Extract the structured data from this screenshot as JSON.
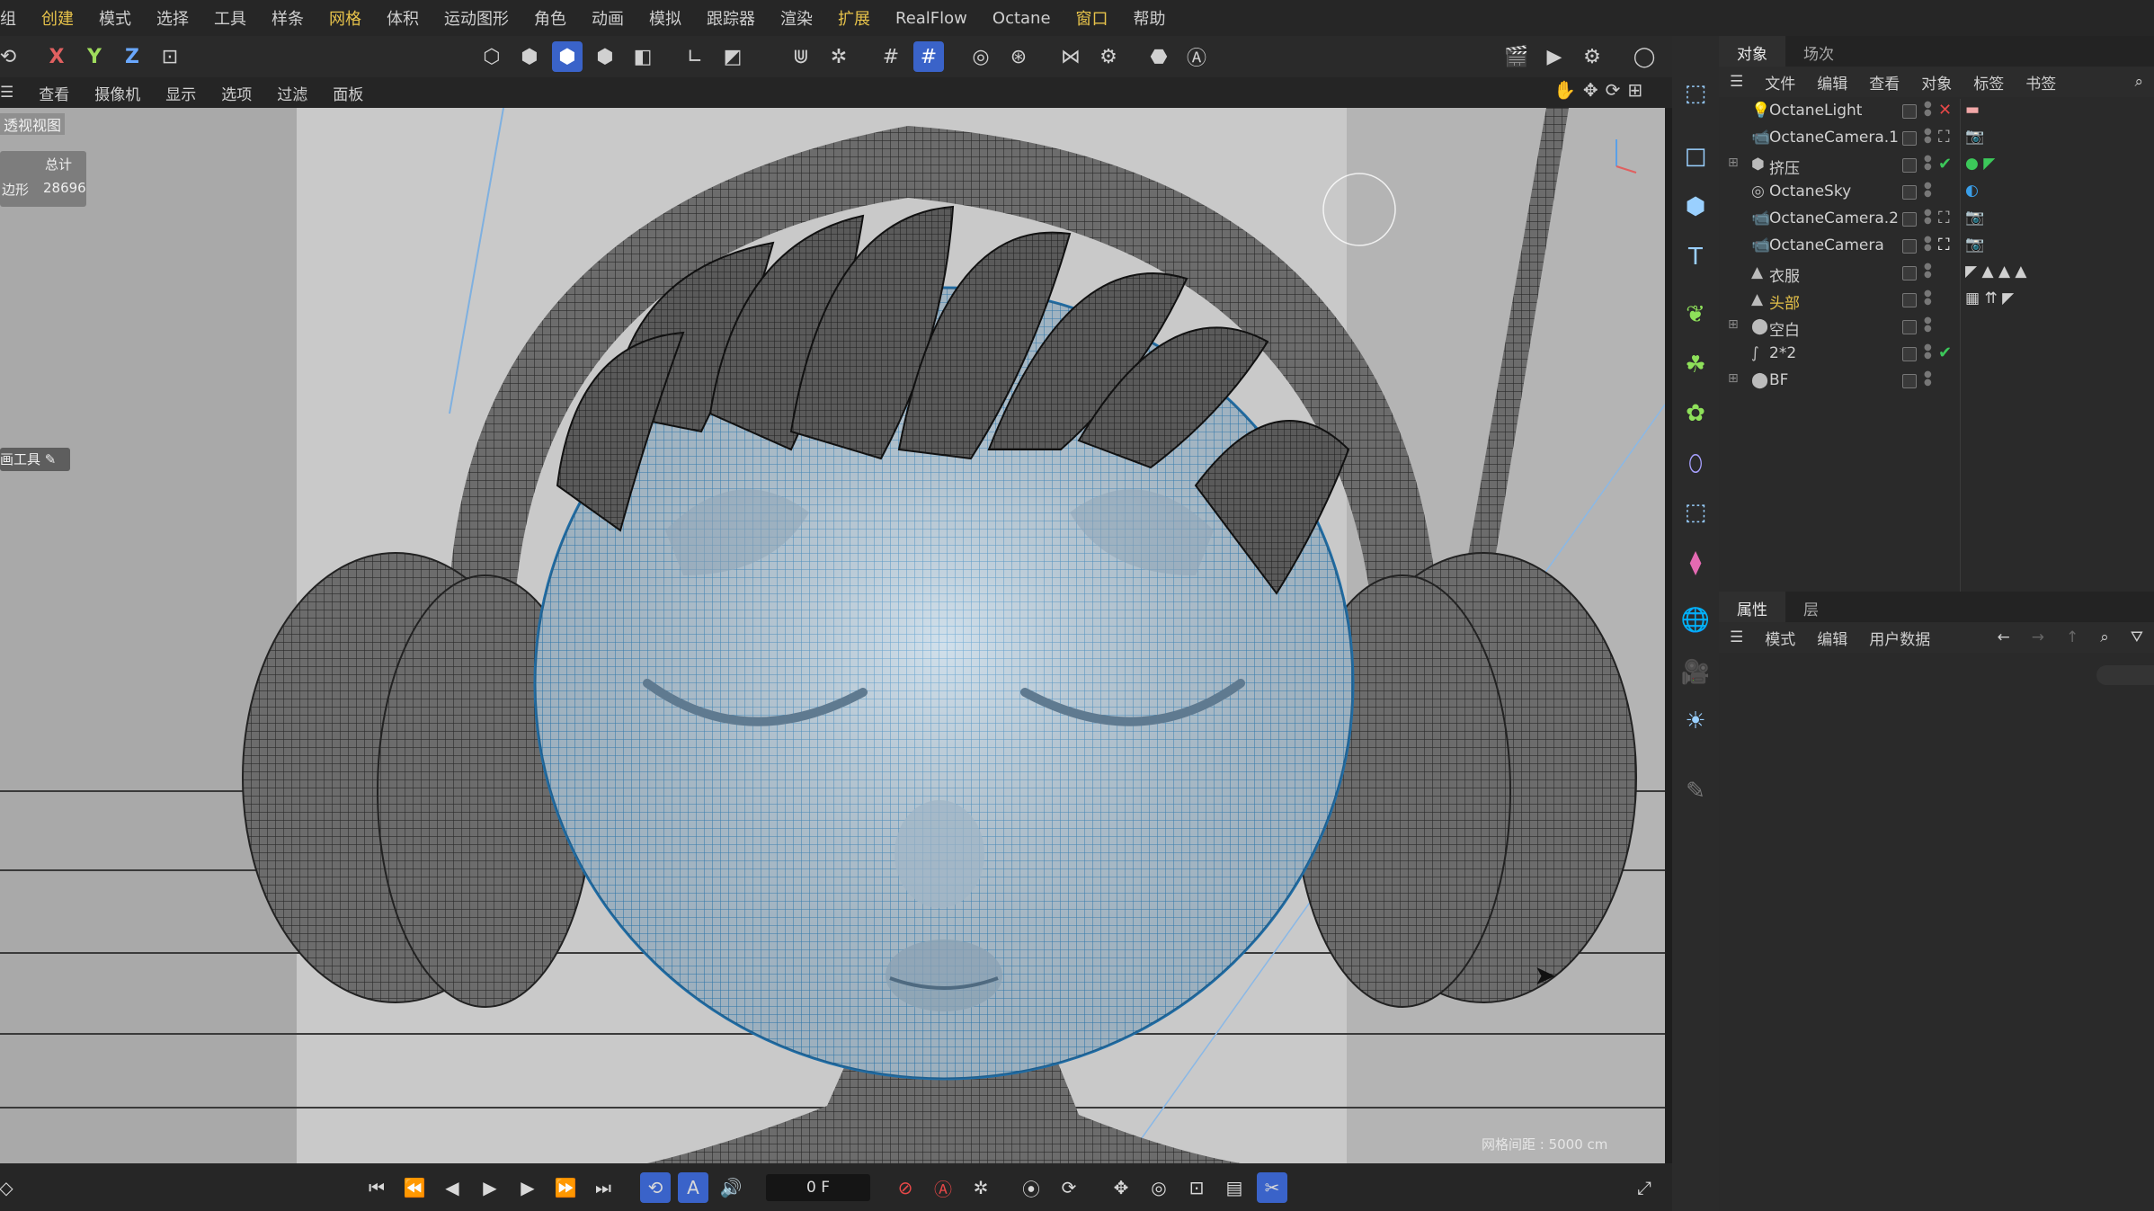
{
  "menu": [
    "组",
    "创建",
    "模式",
    "选择",
    "工具",
    "样条",
    "网格",
    "体积",
    "运动图形",
    "角色",
    "动画",
    "模拟",
    "跟踪器",
    "渲染",
    "扩展",
    "RealFlow",
    "Octane",
    "窗口",
    "帮助"
  ],
  "menu_highlight": [
    "创建",
    "网格",
    "扩展",
    "窗口"
  ],
  "axes": {
    "x": "X",
    "y": "Y",
    "z": "Z"
  },
  "viewport_menu": [
    "查看",
    "摄像机",
    "显示",
    "选项",
    "过滤",
    "面板"
  ],
  "viewport": {
    "view_label": "透视视图",
    "stats_title": "总计",
    "stats_label": "边形",
    "stats_value": "28696",
    "tool_label": "画工具",
    "grid_spacing": "网格间距 : 5000 cm"
  },
  "timeline": {
    "frame": "0 F"
  },
  "object_manager": {
    "tabs": [
      "对象",
      "场次"
    ],
    "submenu": [
      "文件",
      "编辑",
      "查看",
      "对象",
      "标签",
      "书签"
    ],
    "objects": [
      {
        "name": "OctaneLight",
        "icon": "light-icon",
        "status": "✕",
        "status_color": "#e84848",
        "tags": "▬"
      },
      {
        "name": "OctaneCamera.1",
        "icon": "camera-icon",
        "status": "⛶",
        "status_color": "#bbbbbb",
        "tags": "📷"
      },
      {
        "name": "挤压",
        "icon": "extrude-icon",
        "status": "✔",
        "status_color": "#3cc85a",
        "tags": "● ◤"
      },
      {
        "name": "OctaneSky",
        "icon": "sky-icon",
        "status": "",
        "status_color": "#bbbbbb",
        "tags": "◐"
      },
      {
        "name": "OctaneCamera.2",
        "icon": "camera-icon",
        "status": "⛶",
        "status_color": "#bbbbbb",
        "tags": "📷"
      },
      {
        "name": "OctaneCamera",
        "icon": "camera-icon",
        "status": "⛶",
        "status_color": "#ffffff",
        "tags": "📷"
      },
      {
        "name": "衣服",
        "icon": "mesh-icon",
        "status": "",
        "status_color": "#bbbbbb",
        "tags": "◤ ▲ ▲ ▲"
      },
      {
        "name": "头部",
        "icon": "mesh-icon",
        "status": "",
        "status_color": "#bbbbbb",
        "tags": "▦ ⇈ ◤",
        "highlight": true
      },
      {
        "name": "空白",
        "icon": "null-icon",
        "status": "",
        "status_color": "#bbbbbb",
        "tags": ""
      },
      {
        "name": "2*2",
        "icon": "spline-icon",
        "status": "✔",
        "status_color": "#3cc85a",
        "tags": ""
      },
      {
        "name": "BF",
        "icon": "null-icon",
        "status": "",
        "status_color": "#bbbbbb",
        "tags": ""
      }
    ]
  },
  "attributes": {
    "tabs": [
      "属性",
      "层"
    ],
    "submenu": [
      "模式",
      "编辑",
      "用户数据"
    ]
  },
  "colors": {
    "accent": "#3a63c9",
    "highlight": "#e6c24a",
    "mesh": "#3b8fc8"
  }
}
